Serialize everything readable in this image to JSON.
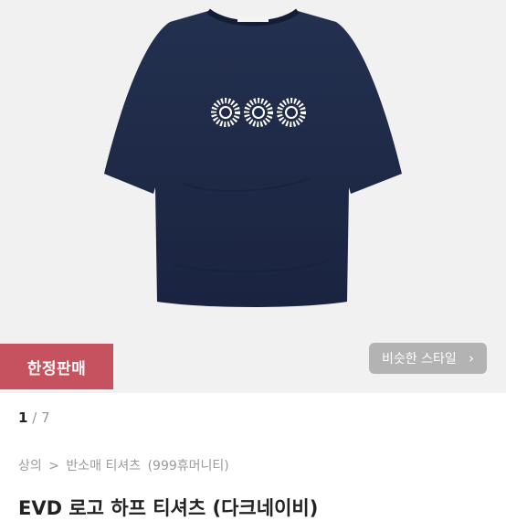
{
  "product_image": {
    "alt": "navy t-shirt with three flower prints",
    "colors": {
      "background": "#f1f1f1",
      "shirt": "#1e2a47",
      "print": "#ffffff"
    }
  },
  "badge": {
    "label": "한정판매",
    "color": "#c5525e"
  },
  "similar_style_button": {
    "label": "비슷한 스타일",
    "icon": "chevron-right-icon",
    "color": "#b3b3b3"
  },
  "pager": {
    "current": "1",
    "separator": "/",
    "total": "7"
  },
  "breadcrumb": {
    "items": [
      "상의",
      "반소매 티셔츠",
      "(999휴머니티)"
    ],
    "separator": ">"
  },
  "product_title": "EVD 로고 하프 티셔츠 (다크네이비)"
}
